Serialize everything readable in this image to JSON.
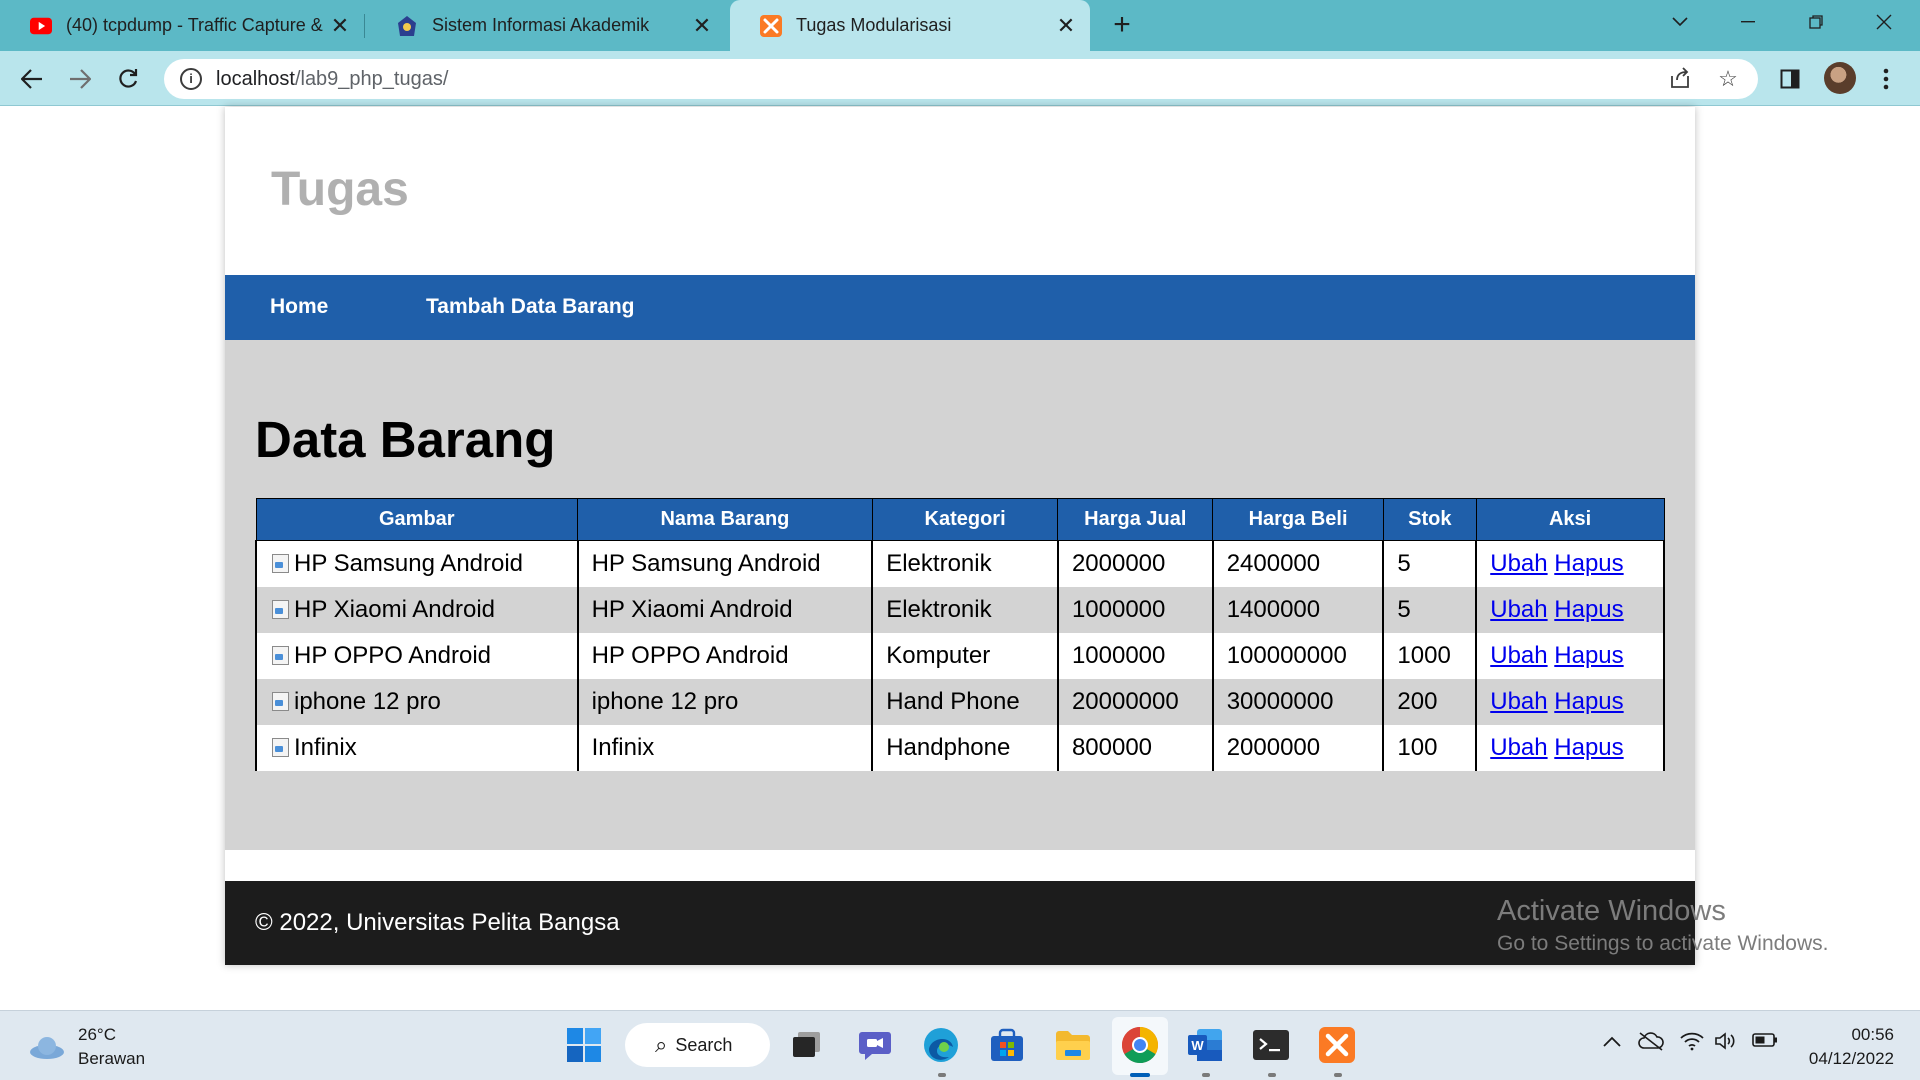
{
  "browser": {
    "tabs": [
      {
        "title": "(40) tcpdump - Traffic Capture & ",
        "favicon": "youtube-icon",
        "active": false
      },
      {
        "title": "Sistem Informasi Akademik",
        "favicon": "campus-logo-icon",
        "active": false
      },
      {
        "title": "Tugas Modularisasi",
        "favicon": "xampp-icon",
        "active": true
      }
    ],
    "url_host": "localhost",
    "url_path": "/lab9_php_tugas/",
    "colors": {
      "tab_strip": "#5cb9c6",
      "toolbar": "#b9e5ec"
    }
  },
  "site": {
    "title": "Tugas",
    "nav": [
      {
        "label": "Home"
      },
      {
        "label": "Tambah Data Barang"
      }
    ],
    "heading": "Data Barang",
    "table": {
      "headers": [
        "Gambar",
        "Nama Barang",
        "Kategori",
        "Harga Jual",
        "Harga Beli",
        "Stok",
        "Aksi"
      ],
      "rows": [
        {
          "gambar_alt": "HP Samsung Android",
          "nama": "HP Samsung Android",
          "kategori": "Elektronik",
          "harga_jual": "2000000",
          "harga_beli": "2400000",
          "stok": "5",
          "ubah": "Ubah",
          "hapus": "Hapus"
        },
        {
          "gambar_alt": "HP Xiaomi Android",
          "nama": "HP Xiaomi Android",
          "kategori": "Elektronik",
          "harga_jual": "1000000",
          "harga_beli": "1400000",
          "stok": "5",
          "ubah": "Ubah",
          "hapus": "Hapus"
        },
        {
          "gambar_alt": "HP OPPO Android",
          "nama": "HP OPPO Android",
          "kategori": "Komputer",
          "harga_jual": "1000000",
          "harga_beli": "100000000",
          "stok": "1000",
          "ubah": "Ubah",
          "hapus": "Hapus"
        },
        {
          "gambar_alt": "iphone 12 pro",
          "nama": "iphone 12 pro",
          "kategori": "Hand Phone",
          "harga_jual": "20000000",
          "harga_beli": "30000000",
          "stok": "200",
          "ubah": "Ubah",
          "hapus": "Hapus"
        },
        {
          "gambar_alt": "Infinix",
          "nama": "Infinix",
          "kategori": "Handphone",
          "harga_jual": "800000",
          "harga_beli": "2000000",
          "stok": "100",
          "ubah": "Ubah",
          "hapus": "Hapus"
        }
      ]
    },
    "footer": "© 2022, Universitas Pelita Bangsa",
    "colors": {
      "nav": "#1f5faa",
      "main_bg": "#d3d3d3",
      "footer_bg": "#1c1c1c",
      "title": "#b0b0b0"
    }
  },
  "watermark": {
    "line1": "Activate Windows",
    "line2": "Go to Settings to activate Windows."
  },
  "taskbar": {
    "weather_temp": "26°C",
    "weather_desc": "Berawan",
    "search_label": "Search",
    "time": "00:56",
    "date": "04/12/2022"
  }
}
